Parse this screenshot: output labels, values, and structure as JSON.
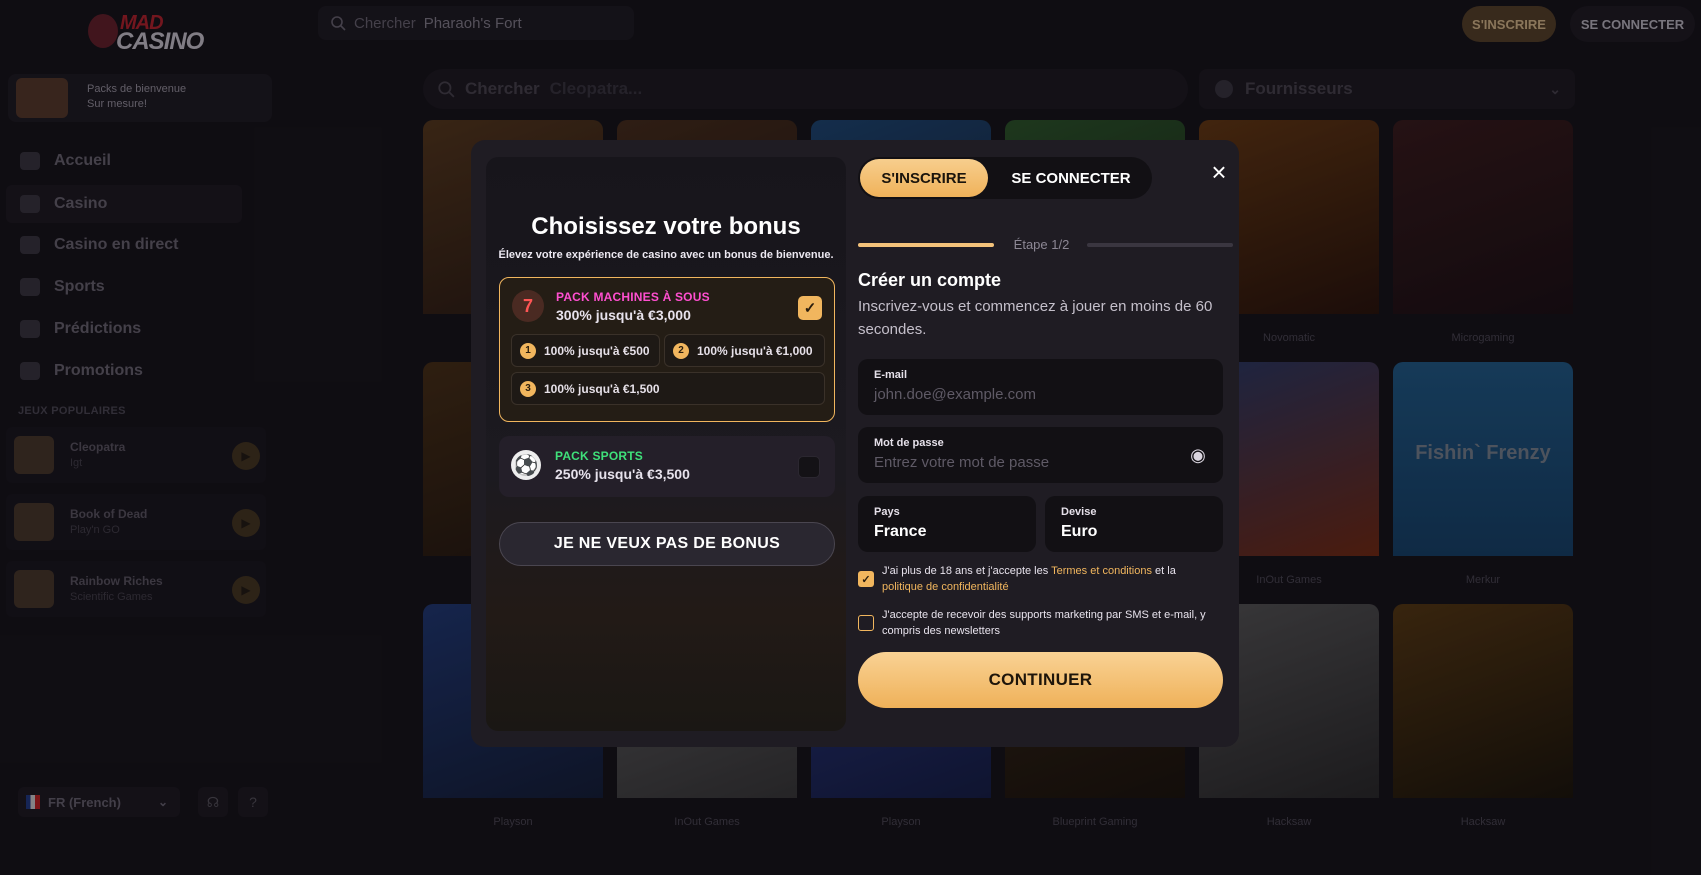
{
  "site": {
    "top_search_placeholder": "Chercher",
    "top_search_hint": "Pharaoh's Fort",
    "btn_signup": "S'INSCRIRE",
    "btn_login": "SE CONNECTER",
    "logo_line1": "MAD",
    "logo_line2": "CASINO"
  },
  "sidebar": {
    "promo_line1": "Packs de bienvenue",
    "promo_line2": "Sur mesure!",
    "nav": [
      "Accueil",
      "Casino",
      "Casino en direct",
      "Sports",
      "Prédictions",
      "Promotions"
    ],
    "popular_title": "JEUX POPULAIRES",
    "popular": [
      {
        "name": "Cleopatra",
        "provider": "Igt"
      },
      {
        "name": "Book of Dead",
        "provider": "Play'n GO"
      },
      {
        "name": "Rainbow Riches",
        "provider": "Scientific Games"
      }
    ],
    "language": "FR (French)"
  },
  "games": {
    "search_placeholder": "Chercher",
    "search_hint": "Cleopatra...",
    "providers_label": "Fournisseurs",
    "providers_row1": [
      "",
      "",
      "",
      "",
      "Novomatic",
      "Microgaming"
    ],
    "providers_row2": [
      "",
      "",
      "",
      "",
      "InOut Games",
      "Merkur"
    ],
    "providers_row3": [
      "Playson",
      "InOut Games",
      "Playson",
      "Blueprint Gaming",
      "Hacksaw",
      "Hacksaw"
    ],
    "tile_fishin_name": "Fishin` Frenzy"
  },
  "modal": {
    "bonus_title": "Choisissez votre bonus",
    "bonus_subtitle": "Élevez votre expérience de casino avec un bonus de bienvenue.",
    "pack_slots": {
      "label": "PACK MACHINES À SOUS",
      "offer": "300% jusqu'à €3,000",
      "icon": "7",
      "tiers": [
        {
          "num": "1",
          "text": "100% jusqu'à €500"
        },
        {
          "num": "2",
          "text": "100% jusqu'à €1,000"
        },
        {
          "num": "3",
          "text": "100% jusqu'à €1,500"
        }
      ]
    },
    "pack_sports": {
      "label": "PACK SPORTS",
      "offer": "250% jusqu'à €3,500"
    },
    "no_bonus": "JE NE VEUX PAS DE BONUS",
    "tab_signup": "S'INSCRIRE",
    "tab_login": "SE CONNECTER",
    "close_icon": "×",
    "step": "Étape 1/2",
    "create_title": "Créer un compte",
    "create_sub": "Inscrivez-vous et commencez à jouer en moins de 60 secondes.",
    "email": {
      "label": "E-mail",
      "placeholder": "john.doe@example.com"
    },
    "password": {
      "label": "Mot de passe",
      "placeholder": "Entrez votre mot de passe"
    },
    "country": {
      "label": "Pays",
      "value": "France"
    },
    "currency": {
      "label": "Devise",
      "value": "Euro"
    },
    "consent_age": {
      "before": "J'ai plus de 18 ans et j'accepte les ",
      "link1": "Termes et conditions",
      "middle": " et la ",
      "link2": "politique de confidentialité"
    },
    "consent_marketing": "J'accepte de recevoir des supports marketing par SMS et e-mail, y compris des newsletters",
    "continue": "CONTINUER"
  },
  "colors": {
    "accent": "#f1b65e",
    "slots_label": "#ff4fd0",
    "sports_label": "#3fe07a"
  }
}
